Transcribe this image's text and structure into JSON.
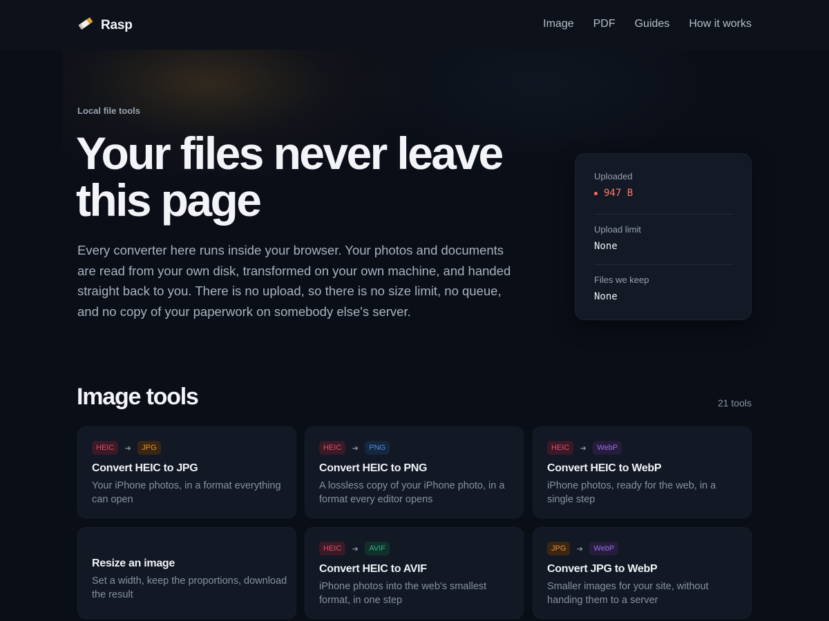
{
  "header": {
    "brand": "Rasp",
    "nav": [
      "Image",
      "PDF",
      "Guides",
      "How it works"
    ]
  },
  "hero": {
    "eyebrow": "Local file tools",
    "title_line1": "Your files never leave",
    "title_line2": "this page",
    "lede": "Every converter here runs inside your browser. Your photos and documents are read from your own disk, transformed on your own machine, and handed straight back to you. There is no upload, so there is no size limit, no queue, and no copy of your paperwork on somebody else's server."
  },
  "stats": [
    {
      "label": "Uploaded",
      "value": "947 B"
    },
    {
      "label": "Upload limit",
      "value": "None"
    },
    {
      "label": "Files we keep",
      "value": "None"
    }
  ],
  "tools_section": {
    "title": "Image tools",
    "count": "21 tools"
  },
  "tools": [
    {
      "from": "HEIC",
      "to": "JPG",
      "title": "Convert HEIC to JPG",
      "desc": "Your iPhone photos, in a format everything can open"
    },
    {
      "from": "HEIC",
      "to": "PNG",
      "title": "Convert HEIC to PNG",
      "desc": "A lossless copy of your iPhone photo, in a format every editor opens"
    },
    {
      "from": "HEIC",
      "to": "WebP",
      "title": "Convert HEIC to WebP",
      "desc": "iPhone photos, ready for the web, in a single step"
    },
    {
      "from": "",
      "to": "",
      "title": "Resize an image",
      "desc": "Set a width, keep the proportions, download the result"
    },
    {
      "from": "HEIC",
      "to": "AVIF",
      "title": "Convert HEIC to AVIF",
      "desc": "iPhone photos into the web's smallest format, in one step"
    },
    {
      "from": "JPG",
      "to": "WebP",
      "title": "Convert JPG to WebP",
      "desc": "Smaller images for your site, without handing them to a server"
    }
  ],
  "colors": {
    "heic": "#e0506e",
    "jpg": "#e8902e",
    "png": "#4a8fe0",
    "webp": "#9a6fe0",
    "avif": "#2fb38a"
  }
}
